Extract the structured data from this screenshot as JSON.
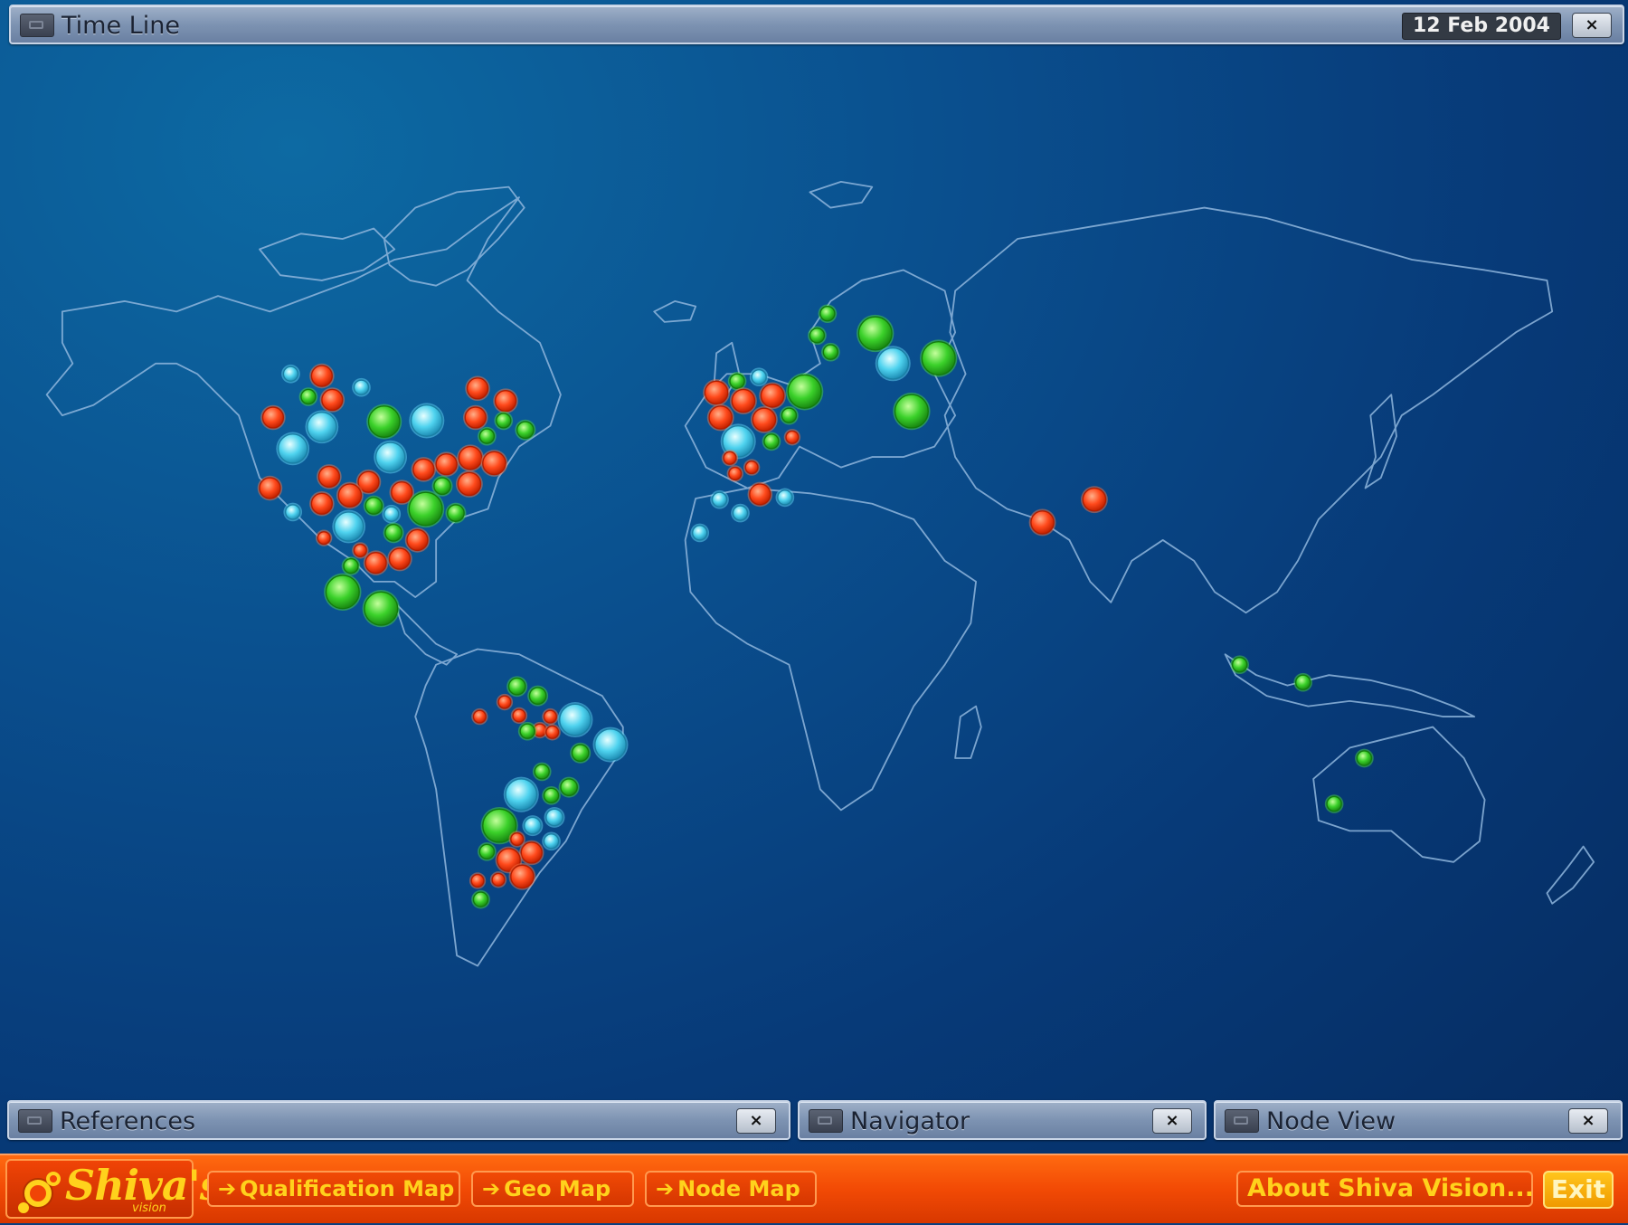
{
  "top_panel": {
    "title": "Time Line",
    "date": "12 Feb 2004",
    "close": "×"
  },
  "bottom_panels": [
    {
      "title": "References",
      "close": "×"
    },
    {
      "title": "Navigator",
      "close": "×"
    },
    {
      "title": "Node View",
      "close": "×"
    }
  ],
  "logo": {
    "text": "Shiva's",
    "sub": "vision"
  },
  "nav_buttons": [
    {
      "arrow": "➔",
      "label": "Qualification Map"
    },
    {
      "arrow": "➔",
      "label": "Geo Map"
    },
    {
      "arrow": "➔",
      "label": "Node Map"
    }
  ],
  "about_button": "About Shiva Vision...",
  "exit_button": "Exit",
  "colors": {
    "red_node": "#ff4a1c",
    "green_node": "#3bd12a",
    "cyan_node": "#4fd3ef",
    "map_line": "#8fb6dd",
    "accent": "#ff5a0a"
  }
}
